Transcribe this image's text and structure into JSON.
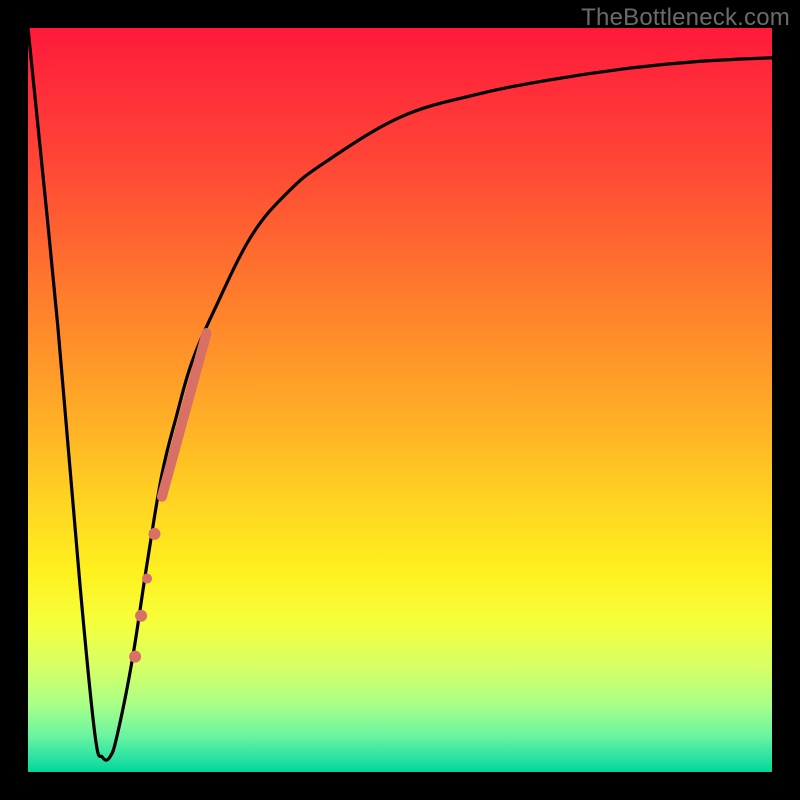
{
  "watermark": "TheBottleneck.com",
  "chart_data": {
    "type": "line",
    "title": "",
    "xlabel": "",
    "ylabel": "",
    "xlim": [
      0,
      100
    ],
    "ylim": [
      0,
      100
    ],
    "series": [
      {
        "name": "bottleneck-curve",
        "x": [
          0,
          4,
          7,
          9,
          10,
          11,
          12,
          14,
          16,
          18,
          20,
          22,
          25,
          30,
          35,
          40,
          50,
          60,
          70,
          80,
          90,
          100
        ],
        "y": [
          100,
          60,
          25,
          5,
          2,
          2,
          5,
          15,
          28,
          40,
          48,
          55,
          62,
          72,
          78,
          82,
          88,
          91,
          93,
          94.5,
          95.5,
          96
        ]
      }
    ],
    "markers": {
      "name": "highlight-region",
      "color": "#d87065",
      "segments": [
        {
          "x0": 18.0,
          "y0": 37.0,
          "x1": 24.0,
          "y1": 59.0,
          "width": 10
        }
      ],
      "dots": [
        {
          "x": 17.0,
          "y": 32.0,
          "r": 6
        },
        {
          "x": 16.0,
          "y": 26.0,
          "r": 5
        },
        {
          "x": 15.2,
          "y": 21.0,
          "r": 6
        },
        {
          "x": 14.4,
          "y": 15.5,
          "r": 6
        }
      ]
    },
    "gradient_stops": [
      {
        "pos": 0,
        "color": "#ff1a3a"
      },
      {
        "pos": 18,
        "color": "#ff4636"
      },
      {
        "pos": 42,
        "color": "#ff8e2a"
      },
      {
        "pos": 64,
        "color": "#ffd522"
      },
      {
        "pos": 80,
        "color": "#f6ff3c"
      },
      {
        "pos": 95,
        "color": "#6cf5a0"
      },
      {
        "pos": 100,
        "color": "#00d79a"
      }
    ]
  }
}
